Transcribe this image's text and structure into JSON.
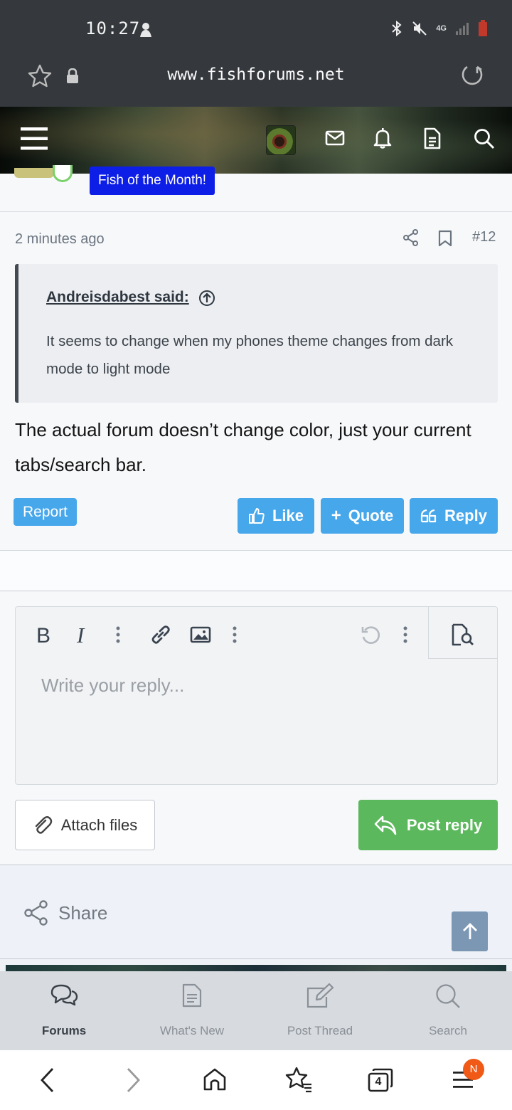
{
  "status_bar": {
    "time": "10:27",
    "network": "4G",
    "icons": [
      "notification-icon",
      "bluetooth-icon",
      "mute-icon",
      "signal-icon",
      "battery-icon"
    ]
  },
  "browser": {
    "url": "www.fishforums.net",
    "icons": [
      "bookmark-star-icon",
      "lock-icon",
      "reload-icon"
    ]
  },
  "forum_header": {
    "icons": [
      "menu-icon",
      "user-avatar",
      "inbox-icon",
      "alerts-icon",
      "whats-new-icon",
      "search-icon"
    ]
  },
  "previous_post": {
    "badge": "Fish of the Month!"
  },
  "post": {
    "time": "2 minutes ago",
    "number": "#12",
    "quote": {
      "author": "Andreisdabest said:",
      "text": "It seems to change when my phones theme changes from dark mode to light mode"
    },
    "body": "The actual forum doesn’t change color, just your current tabs/search bar.",
    "report_label": "Report",
    "like_label": "Like",
    "quote_label": "Quote",
    "reply_label": "Reply"
  },
  "reply_form": {
    "placeholder": "Write your reply...",
    "attach_label": "Attach files",
    "post_label": "Post reply",
    "toolbar": [
      "bold-icon",
      "italic-icon",
      "more-text-icon",
      "link-icon",
      "image-icon",
      "more-insert-icon",
      "undo-icon",
      "more-options-icon",
      "preview-icon"
    ]
  },
  "share": {
    "label": "Share"
  },
  "bottom_nav": {
    "items": [
      {
        "label": "Forums",
        "active": true
      },
      {
        "label": "What's New",
        "active": false
      },
      {
        "label": "Post Thread",
        "active": false
      },
      {
        "label": "Search",
        "active": false
      }
    ]
  },
  "browser_nav": {
    "tab_count": "4",
    "menu_badge": "N"
  },
  "colors": {
    "accent": "#47a7eb",
    "post_reply": "#5cb85c",
    "badge_blue": "#0d1ee6",
    "chrome_dark": "#35393e",
    "menu_badge": "#f05a16"
  }
}
